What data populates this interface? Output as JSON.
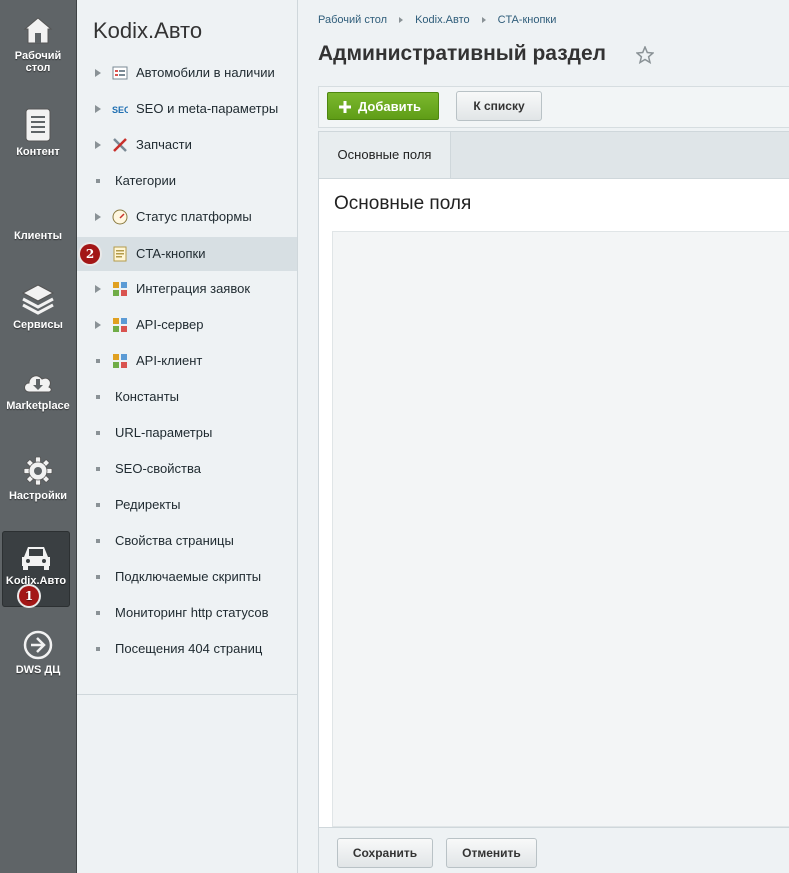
{
  "rail": {
    "items": [
      {
        "label": "Рабочий стол",
        "icon": "home-icon"
      },
      {
        "label": "Контент",
        "icon": "document-icon"
      },
      {
        "label": "Клиенты",
        "icon": "users-icon"
      },
      {
        "label": "Сервисы",
        "icon": "layers-icon"
      },
      {
        "label": "Marketplace",
        "icon": "cloud-download-icon"
      },
      {
        "label": "Настройки",
        "icon": "gear-icon"
      },
      {
        "label": "Kodix.Авто",
        "icon": "car-icon",
        "active": true,
        "badge": "1"
      },
      {
        "label": "DWS ДЦ",
        "icon": "arrow-right-circle-icon"
      }
    ]
  },
  "menu": {
    "title": "Kodix.Авто",
    "items": [
      {
        "label": "Автомобили в наличии",
        "kind": "arrow",
        "icon": "car-list-icon"
      },
      {
        "label": "SEO и meta-параметры",
        "kind": "arrow",
        "icon": "seo-icon"
      },
      {
        "label": "Запчасти",
        "kind": "arrow",
        "icon": "tools-icon"
      },
      {
        "label": "Категории",
        "kind": "dot"
      },
      {
        "label": "Статус платформы",
        "kind": "arrow",
        "icon": "gauge-icon"
      },
      {
        "label": "CTA-кнопки",
        "kind": "badge",
        "icon": "note-icon",
        "active": true,
        "badge": "2"
      },
      {
        "label": "Интеграция заявок",
        "kind": "arrow",
        "icon": "integration-icon"
      },
      {
        "label": "API-сервер",
        "kind": "arrow",
        "icon": "integration-icon"
      },
      {
        "label": "API-клиент",
        "kind": "dot",
        "icon": "integration-icon"
      },
      {
        "label": "Константы",
        "kind": "dot"
      },
      {
        "label": "URL-параметры",
        "kind": "dot"
      },
      {
        "label": "SEO-свойства",
        "kind": "dot"
      },
      {
        "label": "Редиректы",
        "kind": "dot"
      },
      {
        "label": "Свойства страницы",
        "kind": "dot"
      },
      {
        "label": "Подключаемые скрипты",
        "kind": "dot"
      },
      {
        "label": "Мониторинг http статусов",
        "kind": "dot"
      },
      {
        "label": "Посещения 404 страниц",
        "kind": "dot"
      }
    ]
  },
  "breadcrumb": [
    "Рабочий стол",
    "Kodix.Авто",
    "CTA-кнопки"
  ],
  "page_title": "Административный раздел",
  "toolbar": {
    "add_label": "Добавить",
    "list_label": "К списку"
  },
  "tabs": [
    {
      "label": "Основные поля"
    }
  ],
  "panel": {
    "title": "Основные поля"
  },
  "footer": {
    "save_label": "Сохранить",
    "cancel_label": "Отменить"
  },
  "colors": {
    "accent_green": "#6aa81f",
    "badge_red": "#a31616",
    "rail_bg": "#5f6467"
  }
}
